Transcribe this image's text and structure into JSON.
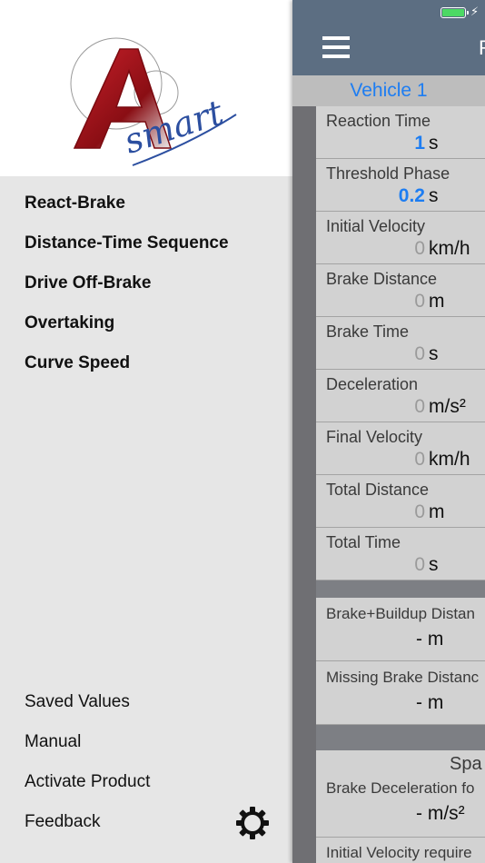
{
  "status_bar": {
    "bolt": "⚡"
  },
  "drawer": {
    "logo_text": "smart",
    "main_menu": [
      {
        "label": "React-Brake"
      },
      {
        "label": "Distance-Time Sequence"
      },
      {
        "label": "Drive Off-Brake"
      },
      {
        "label": "Overtaking"
      },
      {
        "label": "Curve Speed"
      }
    ],
    "bottom_menu": [
      {
        "label": "Saved Values"
      },
      {
        "label": "Manual"
      },
      {
        "label": "Activate Product"
      },
      {
        "label": "Feedback"
      }
    ],
    "settings_icon": "gear-icon"
  },
  "panel": {
    "nav_title": "R",
    "vehicle_tab": "Vehicle 1",
    "inputs": [
      {
        "label": "Reaction Time",
        "value": "1",
        "unit": "s"
      },
      {
        "label": "Threshold Phase",
        "value": "0.2",
        "unit": "s"
      },
      {
        "label": "Initial Velocity",
        "value": "0",
        "unit": "km/h"
      },
      {
        "label": "Brake Distance",
        "value": "0",
        "unit": "m"
      },
      {
        "label": "Brake Time",
        "value": "0",
        "unit": "s"
      },
      {
        "label": "Deceleration",
        "value": "0",
        "unit": "m/s²"
      },
      {
        "label": "Final Velocity",
        "value": "0",
        "unit": "km/h"
      },
      {
        "label": "Total Distance",
        "value": "0",
        "unit": "m"
      },
      {
        "label": "Total Time",
        "value": "0",
        "unit": "s"
      }
    ],
    "results": [
      {
        "label": "Brake+Buildup Distan",
        "value": "- m"
      },
      {
        "label": "Missing Brake Distanc",
        "value": "- m"
      }
    ],
    "section": {
      "title": "Spa",
      "rows": [
        {
          "label": "Brake Deceleration fo",
          "value": "- m/s²"
        },
        {
          "label": "Initial Velocity require",
          "value": ""
        }
      ]
    }
  },
  "colors": {
    "accent": "#1d7df2",
    "navbar": "#5c6e82",
    "logo_red": "#a8141c",
    "logo_blue": "#2c4fa0"
  }
}
